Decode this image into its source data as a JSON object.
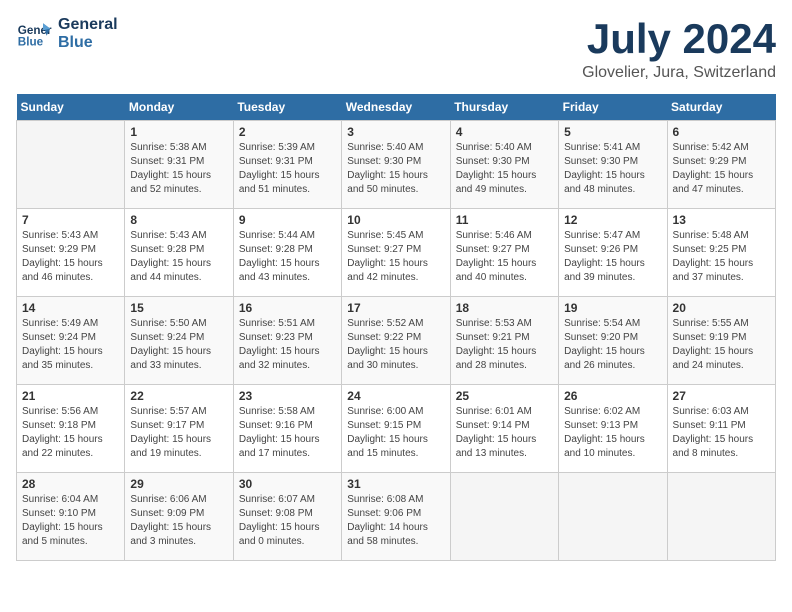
{
  "header": {
    "logo_line1": "General",
    "logo_line2": "Blue",
    "month": "July 2024",
    "location": "Glovelier, Jura, Switzerland"
  },
  "weekdays": [
    "Sunday",
    "Monday",
    "Tuesday",
    "Wednesday",
    "Thursday",
    "Friday",
    "Saturday"
  ],
  "weeks": [
    [
      {
        "day": "",
        "info": ""
      },
      {
        "day": "1",
        "info": "Sunrise: 5:38 AM\nSunset: 9:31 PM\nDaylight: 15 hours\nand 52 minutes."
      },
      {
        "day": "2",
        "info": "Sunrise: 5:39 AM\nSunset: 9:31 PM\nDaylight: 15 hours\nand 51 minutes."
      },
      {
        "day": "3",
        "info": "Sunrise: 5:40 AM\nSunset: 9:30 PM\nDaylight: 15 hours\nand 50 minutes."
      },
      {
        "day": "4",
        "info": "Sunrise: 5:40 AM\nSunset: 9:30 PM\nDaylight: 15 hours\nand 49 minutes."
      },
      {
        "day": "5",
        "info": "Sunrise: 5:41 AM\nSunset: 9:30 PM\nDaylight: 15 hours\nand 48 minutes."
      },
      {
        "day": "6",
        "info": "Sunrise: 5:42 AM\nSunset: 9:29 PM\nDaylight: 15 hours\nand 47 minutes."
      }
    ],
    [
      {
        "day": "7",
        "info": "Sunrise: 5:43 AM\nSunset: 9:29 PM\nDaylight: 15 hours\nand 46 minutes."
      },
      {
        "day": "8",
        "info": "Sunrise: 5:43 AM\nSunset: 9:28 PM\nDaylight: 15 hours\nand 44 minutes."
      },
      {
        "day": "9",
        "info": "Sunrise: 5:44 AM\nSunset: 9:28 PM\nDaylight: 15 hours\nand 43 minutes."
      },
      {
        "day": "10",
        "info": "Sunrise: 5:45 AM\nSunset: 9:27 PM\nDaylight: 15 hours\nand 42 minutes."
      },
      {
        "day": "11",
        "info": "Sunrise: 5:46 AM\nSunset: 9:27 PM\nDaylight: 15 hours\nand 40 minutes."
      },
      {
        "day": "12",
        "info": "Sunrise: 5:47 AM\nSunset: 9:26 PM\nDaylight: 15 hours\nand 39 minutes."
      },
      {
        "day": "13",
        "info": "Sunrise: 5:48 AM\nSunset: 9:25 PM\nDaylight: 15 hours\nand 37 minutes."
      }
    ],
    [
      {
        "day": "14",
        "info": "Sunrise: 5:49 AM\nSunset: 9:24 PM\nDaylight: 15 hours\nand 35 minutes."
      },
      {
        "day": "15",
        "info": "Sunrise: 5:50 AM\nSunset: 9:24 PM\nDaylight: 15 hours\nand 33 minutes."
      },
      {
        "day": "16",
        "info": "Sunrise: 5:51 AM\nSunset: 9:23 PM\nDaylight: 15 hours\nand 32 minutes."
      },
      {
        "day": "17",
        "info": "Sunrise: 5:52 AM\nSunset: 9:22 PM\nDaylight: 15 hours\nand 30 minutes."
      },
      {
        "day": "18",
        "info": "Sunrise: 5:53 AM\nSunset: 9:21 PM\nDaylight: 15 hours\nand 28 minutes."
      },
      {
        "day": "19",
        "info": "Sunrise: 5:54 AM\nSunset: 9:20 PM\nDaylight: 15 hours\nand 26 minutes."
      },
      {
        "day": "20",
        "info": "Sunrise: 5:55 AM\nSunset: 9:19 PM\nDaylight: 15 hours\nand 24 minutes."
      }
    ],
    [
      {
        "day": "21",
        "info": "Sunrise: 5:56 AM\nSunset: 9:18 PM\nDaylight: 15 hours\nand 22 minutes."
      },
      {
        "day": "22",
        "info": "Sunrise: 5:57 AM\nSunset: 9:17 PM\nDaylight: 15 hours\nand 19 minutes."
      },
      {
        "day": "23",
        "info": "Sunrise: 5:58 AM\nSunset: 9:16 PM\nDaylight: 15 hours\nand 17 minutes."
      },
      {
        "day": "24",
        "info": "Sunrise: 6:00 AM\nSunset: 9:15 PM\nDaylight: 15 hours\nand 15 minutes."
      },
      {
        "day": "25",
        "info": "Sunrise: 6:01 AM\nSunset: 9:14 PM\nDaylight: 15 hours\nand 13 minutes."
      },
      {
        "day": "26",
        "info": "Sunrise: 6:02 AM\nSunset: 9:13 PM\nDaylight: 15 hours\nand 10 minutes."
      },
      {
        "day": "27",
        "info": "Sunrise: 6:03 AM\nSunset: 9:11 PM\nDaylight: 15 hours\nand 8 minutes."
      }
    ],
    [
      {
        "day": "28",
        "info": "Sunrise: 6:04 AM\nSunset: 9:10 PM\nDaylight: 15 hours\nand 5 minutes."
      },
      {
        "day": "29",
        "info": "Sunrise: 6:06 AM\nSunset: 9:09 PM\nDaylight: 15 hours\nand 3 minutes."
      },
      {
        "day": "30",
        "info": "Sunrise: 6:07 AM\nSunset: 9:08 PM\nDaylight: 15 hours\nand 0 minutes."
      },
      {
        "day": "31",
        "info": "Sunrise: 6:08 AM\nSunset: 9:06 PM\nDaylight: 14 hours\nand 58 minutes."
      },
      {
        "day": "",
        "info": ""
      },
      {
        "day": "",
        "info": ""
      },
      {
        "day": "",
        "info": ""
      }
    ]
  ]
}
